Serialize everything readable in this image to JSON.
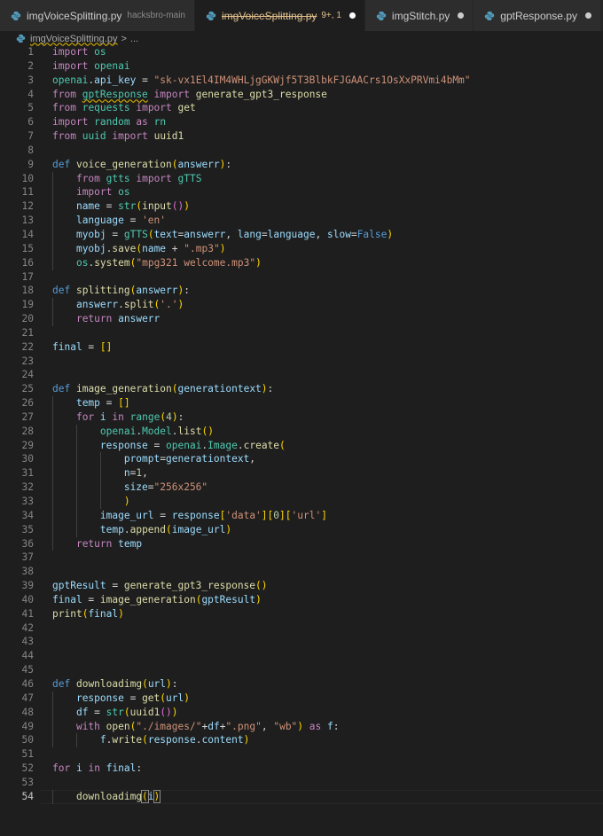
{
  "tabs": [
    {
      "label": "imgVoiceSplitting.py",
      "description": "hacksbro-main",
      "dirty": false,
      "active": false
    },
    {
      "label": "imgVoiceSplitting.py",
      "description": "",
      "problems": "9+, 1",
      "dirty": true,
      "active": true
    },
    {
      "label": "imgStitch.py",
      "description": "",
      "dirty": true,
      "active": false
    },
    {
      "label": "gptResponse.py",
      "description": "",
      "dirty": true,
      "active": false
    }
  ],
  "breadcrumb": {
    "file": "imgVoiceSplitting.py",
    "separator": ">",
    "rest": "..."
  },
  "colors": {
    "keyword": "#c586c0",
    "string": "#ce9178",
    "function": "#dcdcaa",
    "module": "#4ec9b0",
    "variable": "#9cdcfe"
  },
  "editor": {
    "current_line": 54,
    "lines": [
      {
        "n": "1"
      },
      {
        "n": "2"
      },
      {
        "n": "3"
      },
      {
        "n": "4"
      },
      {
        "n": "5"
      },
      {
        "n": "6"
      },
      {
        "n": "7"
      },
      {
        "n": "8"
      },
      {
        "n": "9"
      },
      {
        "n": "10"
      },
      {
        "n": "11"
      },
      {
        "n": "12"
      },
      {
        "n": "13"
      },
      {
        "n": "14"
      },
      {
        "n": "15"
      },
      {
        "n": "16"
      },
      {
        "n": "17"
      },
      {
        "n": "18"
      },
      {
        "n": "19"
      },
      {
        "n": "20"
      },
      {
        "n": "21"
      },
      {
        "n": "22"
      },
      {
        "n": "23"
      },
      {
        "n": "24"
      },
      {
        "n": "25"
      },
      {
        "n": "26"
      },
      {
        "n": "27"
      },
      {
        "n": "28"
      },
      {
        "n": "29"
      },
      {
        "n": "30"
      },
      {
        "n": "31"
      },
      {
        "n": "32"
      },
      {
        "n": "33"
      },
      {
        "n": "34"
      },
      {
        "n": "35"
      },
      {
        "n": "36"
      },
      {
        "n": "37"
      },
      {
        "n": "38"
      },
      {
        "n": "39"
      },
      {
        "n": "40"
      },
      {
        "n": "41"
      },
      {
        "n": "42"
      },
      {
        "n": "43"
      },
      {
        "n": "44"
      },
      {
        "n": "45"
      },
      {
        "n": "46"
      },
      {
        "n": "47"
      },
      {
        "n": "48"
      },
      {
        "n": "49"
      },
      {
        "n": "50"
      },
      {
        "n": "51"
      },
      {
        "n": "52"
      },
      {
        "n": "53"
      },
      {
        "n": "54"
      }
    ],
    "code": [
      [
        [
          "kw",
          "import"
        ],
        [
          "pun",
          " "
        ],
        [
          "mod",
          "os"
        ]
      ],
      [
        [
          "kw",
          "import"
        ],
        [
          "pun",
          " "
        ],
        [
          "mod",
          "openai"
        ]
      ],
      [
        [
          "mod",
          "openai"
        ],
        [
          "pun",
          "."
        ],
        [
          "var",
          "api_key"
        ],
        [
          "pun",
          " = "
        ],
        [
          "str",
          "\"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\""
        ]
      ],
      [
        [
          "kw",
          "from"
        ],
        [
          "pun",
          " "
        ],
        [
          "mod_sq",
          "gptResponse"
        ],
        [
          "pun",
          " "
        ],
        [
          "kw",
          "import"
        ],
        [
          "pun",
          " "
        ],
        [
          "fn",
          "generate_gpt3_response"
        ]
      ],
      [
        [
          "kw",
          "from"
        ],
        [
          "pun",
          " "
        ],
        [
          "mod",
          "requests"
        ],
        [
          "pun",
          " "
        ],
        [
          "kw",
          "import"
        ],
        [
          "pun",
          " "
        ],
        [
          "fn",
          "get"
        ]
      ],
      [
        [
          "kw",
          "import"
        ],
        [
          "pun",
          " "
        ],
        [
          "mod",
          "random"
        ],
        [
          "pun",
          " "
        ],
        [
          "kw",
          "as"
        ],
        [
          "pun",
          " "
        ],
        [
          "mod",
          "rn"
        ]
      ],
      [
        [
          "kw",
          "from"
        ],
        [
          "pun",
          " "
        ],
        [
          "mod",
          "uuid"
        ],
        [
          "pun",
          " "
        ],
        [
          "kw",
          "import"
        ],
        [
          "pun",
          " "
        ],
        [
          "fn",
          "uuid1"
        ]
      ],
      [],
      [
        [
          "def",
          "def"
        ],
        [
          "pun",
          " "
        ],
        [
          "fn",
          "voice_generation"
        ],
        [
          "b1",
          "("
        ],
        [
          "var",
          "answerr"
        ],
        [
          "b1",
          ")"
        ],
        [
          "pun",
          ":"
        ]
      ],
      [
        [
          "pun",
          "    "
        ],
        [
          "kw",
          "from"
        ],
        [
          "pun",
          " "
        ],
        [
          "mod",
          "gtts"
        ],
        [
          "pun",
          " "
        ],
        [
          "kw",
          "import"
        ],
        [
          "pun",
          " "
        ],
        [
          "mod",
          "gTTS"
        ]
      ],
      [
        [
          "pun",
          "    "
        ],
        [
          "kw",
          "import"
        ],
        [
          "pun",
          " "
        ],
        [
          "mod",
          "os"
        ]
      ],
      [
        [
          "pun",
          "    "
        ],
        [
          "var",
          "name"
        ],
        [
          "pun",
          " = "
        ],
        [
          "mod",
          "str"
        ],
        [
          "b1",
          "("
        ],
        [
          "fn",
          "input"
        ],
        [
          "b2",
          "()"
        ],
        [
          "b1",
          ")"
        ]
      ],
      [
        [
          "pun",
          "    "
        ],
        [
          "var",
          "language"
        ],
        [
          "pun",
          " = "
        ],
        [
          "str",
          "'en'"
        ]
      ],
      [
        [
          "pun",
          "    "
        ],
        [
          "var",
          "myobj"
        ],
        [
          "pun",
          " = "
        ],
        [
          "mod",
          "gTTS"
        ],
        [
          "b1",
          "("
        ],
        [
          "var",
          "text"
        ],
        [
          "pun",
          "="
        ],
        [
          "var",
          "answerr"
        ],
        [
          "pun",
          ", "
        ],
        [
          "var",
          "lang"
        ],
        [
          "pun",
          "="
        ],
        [
          "var",
          "language"
        ],
        [
          "pun",
          ", "
        ],
        [
          "var",
          "slow"
        ],
        [
          "pun",
          "="
        ],
        [
          "def",
          "False"
        ],
        [
          "b1",
          ")"
        ]
      ],
      [
        [
          "pun",
          "    "
        ],
        [
          "var",
          "myobj"
        ],
        [
          "pun",
          "."
        ],
        [
          "fn",
          "save"
        ],
        [
          "b1",
          "("
        ],
        [
          "var",
          "name"
        ],
        [
          "pun",
          " + "
        ],
        [
          "str",
          "\".mp3\""
        ],
        [
          "b1",
          ")"
        ]
      ],
      [
        [
          "pun",
          "    "
        ],
        [
          "mod",
          "os"
        ],
        [
          "pun",
          "."
        ],
        [
          "fn",
          "system"
        ],
        [
          "b1",
          "("
        ],
        [
          "str",
          "\"mpg321 welcome.mp3\""
        ],
        [
          "b1",
          ")"
        ]
      ],
      [],
      [
        [
          "def",
          "def"
        ],
        [
          "pun",
          " "
        ],
        [
          "fn",
          "splitting"
        ],
        [
          "b1",
          "("
        ],
        [
          "var",
          "answerr"
        ],
        [
          "b1",
          ")"
        ],
        [
          "pun",
          ":"
        ]
      ],
      [
        [
          "pun",
          "    "
        ],
        [
          "var",
          "answerr"
        ],
        [
          "pun",
          "."
        ],
        [
          "fn",
          "split"
        ],
        [
          "b1",
          "("
        ],
        [
          "str",
          "'.'"
        ],
        [
          "b1",
          ")"
        ]
      ],
      [
        [
          "pun",
          "    "
        ],
        [
          "kw",
          "return"
        ],
        [
          "pun",
          " "
        ],
        [
          "var",
          "answerr"
        ]
      ],
      [],
      [
        [
          "var",
          "final"
        ],
        [
          "pun",
          " = "
        ],
        [
          "b1",
          "[]"
        ]
      ],
      [],
      [],
      [
        [
          "def",
          "def"
        ],
        [
          "pun",
          " "
        ],
        [
          "fn",
          "image_generation"
        ],
        [
          "b1",
          "("
        ],
        [
          "var",
          "generationtext"
        ],
        [
          "b1",
          ")"
        ],
        [
          "pun",
          ":"
        ]
      ],
      [
        [
          "pun",
          "    "
        ],
        [
          "var",
          "temp"
        ],
        [
          "pun",
          " = "
        ],
        [
          "b1",
          "[]"
        ]
      ],
      [
        [
          "pun",
          "    "
        ],
        [
          "kw",
          "for"
        ],
        [
          "pun",
          " "
        ],
        [
          "var",
          "i"
        ],
        [
          "pun",
          " "
        ],
        [
          "kw",
          "in"
        ],
        [
          "pun",
          " "
        ],
        [
          "mod",
          "range"
        ],
        [
          "b1",
          "("
        ],
        [
          "num",
          "4"
        ],
        [
          "b1",
          ")"
        ],
        [
          "pun",
          ":"
        ]
      ],
      [
        [
          "pun",
          "        "
        ],
        [
          "mod",
          "openai"
        ],
        [
          "pun",
          "."
        ],
        [
          "mod",
          "Model"
        ],
        [
          "pun",
          "."
        ],
        [
          "fn",
          "list"
        ],
        [
          "b1",
          "()"
        ]
      ],
      [
        [
          "pun",
          "        "
        ],
        [
          "var",
          "response"
        ],
        [
          "pun",
          " = "
        ],
        [
          "mod",
          "openai"
        ],
        [
          "pun",
          "."
        ],
        [
          "mod",
          "Image"
        ],
        [
          "pun",
          "."
        ],
        [
          "fn",
          "create"
        ],
        [
          "b1",
          "("
        ]
      ],
      [
        [
          "pun",
          "            "
        ],
        [
          "var",
          "prompt"
        ],
        [
          "pun",
          "="
        ],
        [
          "var",
          "generationtext"
        ],
        [
          "pun",
          ","
        ]
      ],
      [
        [
          "pun",
          "            "
        ],
        [
          "var",
          "n"
        ],
        [
          "pun",
          "="
        ],
        [
          "num",
          "1"
        ],
        [
          "pun",
          ","
        ]
      ],
      [
        [
          "pun",
          "            "
        ],
        [
          "var",
          "size"
        ],
        [
          "pun",
          "="
        ],
        [
          "str",
          "\"256x256\""
        ]
      ],
      [
        [
          "pun",
          "            "
        ],
        [
          "b1",
          ")"
        ]
      ],
      [
        [
          "pun",
          "        "
        ],
        [
          "var",
          "image_url"
        ],
        [
          "pun",
          " = "
        ],
        [
          "var",
          "response"
        ],
        [
          "b1",
          "["
        ],
        [
          "str",
          "'data'"
        ],
        [
          "b1",
          "]["
        ],
        [
          "num",
          "0"
        ],
        [
          "b1",
          "]["
        ],
        [
          "str",
          "'url'"
        ],
        [
          "b1",
          "]"
        ]
      ],
      [
        [
          "pun",
          "        "
        ],
        [
          "var",
          "temp"
        ],
        [
          "pun",
          "."
        ],
        [
          "fn",
          "append"
        ],
        [
          "b1",
          "("
        ],
        [
          "var",
          "image_url"
        ],
        [
          "b1",
          ")"
        ]
      ],
      [
        [
          "pun",
          "    "
        ],
        [
          "kw",
          "return"
        ],
        [
          "pun",
          " "
        ],
        [
          "var",
          "temp"
        ]
      ],
      [],
      [],
      [
        [
          "var",
          "gptResult"
        ],
        [
          "pun",
          " = "
        ],
        [
          "fn",
          "generate_gpt3_response"
        ],
        [
          "b1",
          "()"
        ]
      ],
      [
        [
          "var",
          "final"
        ],
        [
          "pun",
          " = "
        ],
        [
          "fn",
          "image_generation"
        ],
        [
          "b1",
          "("
        ],
        [
          "var",
          "gptResult"
        ],
        [
          "b1",
          ")"
        ]
      ],
      [
        [
          "fn",
          "print"
        ],
        [
          "b1",
          "("
        ],
        [
          "var",
          "final"
        ],
        [
          "b1",
          ")"
        ]
      ],
      [],
      [],
      [],
      [],
      [
        [
          "def",
          "def"
        ],
        [
          "pun",
          " "
        ],
        [
          "fn",
          "downloadimg"
        ],
        [
          "b1",
          "("
        ],
        [
          "var",
          "url"
        ],
        [
          "b1",
          ")"
        ],
        [
          "pun",
          ":"
        ]
      ],
      [
        [
          "pun",
          "    "
        ],
        [
          "var",
          "response"
        ],
        [
          "pun",
          " = "
        ],
        [
          "fn",
          "get"
        ],
        [
          "b1",
          "("
        ],
        [
          "var",
          "url"
        ],
        [
          "b1",
          ")"
        ]
      ],
      [
        [
          "pun",
          "    "
        ],
        [
          "var",
          "df"
        ],
        [
          "pun",
          " = "
        ],
        [
          "mod",
          "str"
        ],
        [
          "b1",
          "("
        ],
        [
          "fn",
          "uuid1"
        ],
        [
          "b2",
          "()"
        ],
        [
          "b1",
          ")"
        ]
      ],
      [
        [
          "pun",
          "    "
        ],
        [
          "kw",
          "with"
        ],
        [
          "pun",
          " "
        ],
        [
          "fn",
          "open"
        ],
        [
          "b1",
          "("
        ],
        [
          "str",
          "\"./images/\""
        ],
        [
          "pun",
          "+"
        ],
        [
          "var",
          "df"
        ],
        [
          "pun",
          "+"
        ],
        [
          "str",
          "\".png\""
        ],
        [
          "pun",
          ", "
        ],
        [
          "str",
          "\"wb\""
        ],
        [
          "b1",
          ")"
        ],
        [
          "pun",
          " "
        ],
        [
          "kw",
          "as"
        ],
        [
          "pun",
          " "
        ],
        [
          "var",
          "f"
        ],
        [
          "pun",
          ":"
        ]
      ],
      [
        [
          "pun",
          "        "
        ],
        [
          "var",
          "f"
        ],
        [
          "pun",
          "."
        ],
        [
          "fn",
          "write"
        ],
        [
          "b1",
          "("
        ],
        [
          "var",
          "response"
        ],
        [
          "pun",
          "."
        ],
        [
          "var",
          "content"
        ],
        [
          "b1",
          ")"
        ]
      ],
      [],
      [
        [
          "kw",
          "for"
        ],
        [
          "pun",
          " "
        ],
        [
          "var",
          "i"
        ],
        [
          "pun",
          " "
        ],
        [
          "kw",
          "in"
        ],
        [
          "pun",
          " "
        ],
        [
          "var",
          "final"
        ],
        [
          "pun",
          ":"
        ]
      ],
      [],
      [
        [
          "pun",
          "    "
        ],
        [
          "fn",
          "downloadimg"
        ],
        [
          "bm",
          "("
        ],
        [
          "var",
          "i"
        ],
        [
          "bm",
          ")"
        ],
        [
          "cur",
          ""
        ]
      ]
    ]
  }
}
